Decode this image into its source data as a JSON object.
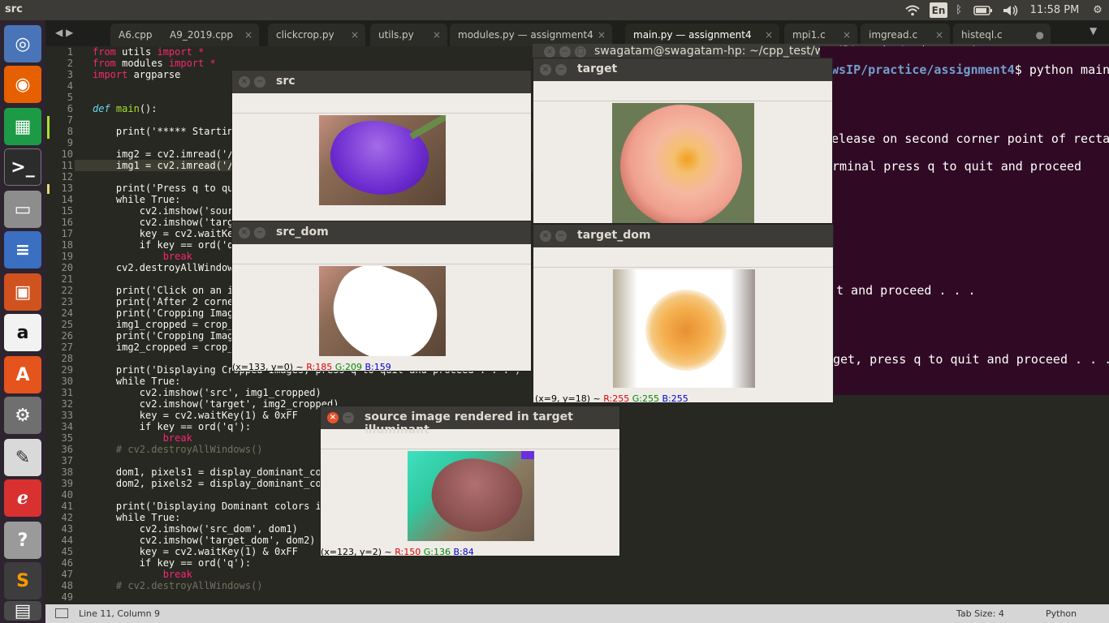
{
  "topbar": {
    "title": "src",
    "lang": "En",
    "clock": "11:58 PM"
  },
  "tabs": [
    {
      "label": "A6.cpp",
      "active": false
    },
    {
      "label": "A9_2019.cpp",
      "active": false
    },
    {
      "label": "clickcrop.py",
      "active": false
    },
    {
      "label": "utils.py",
      "active": false
    },
    {
      "label": "modules.py — assignment4",
      "active": false
    },
    {
      "label": "main.py — assignment4",
      "active": true
    },
    {
      "label": "mpi1.c",
      "active": false
    },
    {
      "label": "imgread.c",
      "active": false
    },
    {
      "label": "histeql.c",
      "active": false
    }
  ],
  "code_lines": [
    "1",
    "2",
    "3",
    "4",
    "5",
    "6",
    "7",
    "8",
    "9",
    "10",
    "11",
    "12",
    "13",
    "14",
    "15",
    "16",
    "17",
    "18",
    "19",
    "20",
    "21",
    "22",
    "23",
    "24",
    "25",
    "26",
    "27",
    "28",
    "29",
    "30",
    "31",
    "32",
    "33",
    "34",
    "35",
    "36",
    "37",
    "38",
    "39",
    "40",
    "41",
    "42",
    "43",
    "44",
    "45",
    "46",
    "47",
    "48",
    "49"
  ],
  "code": {
    "l1": "from utils import *",
    "l2": "from modules import *",
    "l3": "import argparse",
    "l6": "def main():",
    "l8": "    print('***** Starting",
    "l10": "    img2 = cv2.imread('/h",
    "l11": "    img1 = cv2.imread('/h",
    "l13": "    print('Press q to qui",
    "l14": "    while True:",
    "l15": "        cv2.imshow('sourc",
    "l16": "        cv2.imshow('targe",
    "l17": "        key = cv2.waitKey",
    "l18": "        if key == ord('q",
    "l19": "            break",
    "l20": "    cv2.destroyAllWindows",
    "l22": "    print('Click on an im",
    "l23": "    print('After 2 corner",
    "l24": "    print('Cropping Image",
    "l25": "    img1_cropped = crop_",
    "l26": "    print('Cropping Image",
    "l27": "    img2_cropped = crop_",
    "l29": "    print('Displaying Cropped Images, press q to quit and proceed . . .')",
    "l30": "    while True:",
    "l31": "        cv2.imshow('src', img1_cropped)",
    "l32": "        cv2.imshow('target', img2_cropped)",
    "l33": "        key = cv2.waitKey(1) & 0xFF",
    "l34": "        if key == ord('q'):",
    "l35": "            break",
    "l36": "    # cv2.destroyAllWindows()",
    "l38": "    dom1, pixels1 = display_dominant_col",
    "l39": "    dom2, pixels2 = display_dominant_col",
    "l41": "    print('Displaying Dominant colors in",
    "l42": "    while True:",
    "l43": "        cv2.imshow('src_dom', dom1)",
    "l44": "        cv2.imshow('target_dom', dom2)",
    "l45": "        key = cv2.waitKey(1) & 0xFF",
    "l46": "        if key == ord('q'):",
    "l47": "            break",
    "l48": "    # cv2.destroyAllWindows()"
  },
  "status": {
    "position": "Line 11, Column 9",
    "tab_size": "Tab Size: 4",
    "syntax": "Python"
  },
  "terminal": {
    "title": "swagatam@swagatam-hp: ~/cpp_test/wwsIP/practice/assignment4",
    "prompt_path": "wsIP/practice/assignment4",
    "prompt_cmd": "$ python main",
    "line1": "elease on second corner point of rectan",
    "line2": "erminal press q to quit and proceed",
    "line3": "t and proceed . . .",
    "line4": "get, press q to quit and proceed . . ."
  },
  "windows": {
    "src": {
      "title": "src"
    },
    "target": {
      "title": "target"
    },
    "src_dom": {
      "title": "src_dom",
      "xy": "(x=133, y=0) ~ ",
      "r": "R:185",
      "g": "G:209",
      "b": "B:159"
    },
    "target_dom": {
      "title": "target_dom",
      "xy": "(x=9, y=18) ~ ",
      "r": "R:255",
      "g": "G:255",
      "b": "B:255"
    },
    "rendered": {
      "title": "source image rendered in target illuminant",
      "xy": "(x=123, y=2) ~ ",
      "r": "R:150",
      "g": "G:136",
      "b": "B:84"
    }
  },
  "colors": {
    "editor_bg": "#272822",
    "terminal_bg": "#300a24",
    "close_btn": "#e9542a"
  }
}
